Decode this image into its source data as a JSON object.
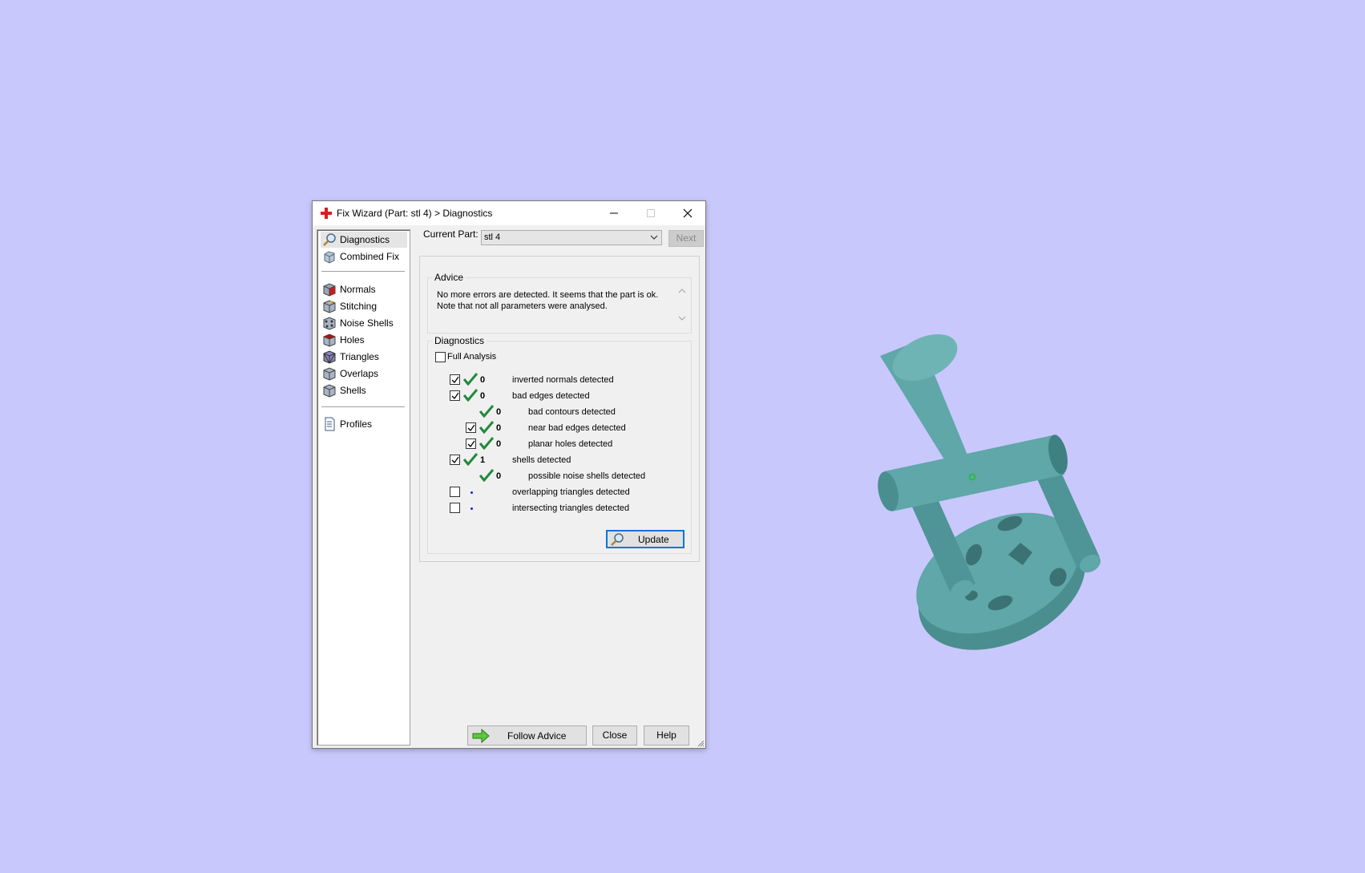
{
  "window": {
    "title": "Fix Wizard (Part: stl 4) > Diagnostics"
  },
  "nav": {
    "items": [
      {
        "label": "Diagnostics",
        "icon": "magnifier-icon"
      },
      {
        "label": "Combined Fix",
        "icon": "combined-fix-icon"
      },
      {
        "label": "Normals",
        "icon": "normals-cube-icon"
      },
      {
        "label": "Stitching",
        "icon": "stitching-cube-icon"
      },
      {
        "label": "Noise Shells",
        "icon": "noise-shells-icon"
      },
      {
        "label": "Holes",
        "icon": "holes-cube-icon"
      },
      {
        "label": "Triangles",
        "icon": "triangles-cube-icon"
      },
      {
        "label": "Overlaps",
        "icon": "overlaps-cube-icon"
      },
      {
        "label": "Shells",
        "icon": "shells-cube-icon"
      },
      {
        "label": "Profiles",
        "icon": "document-icon"
      }
    ],
    "selected": "Diagnostics"
  },
  "current_part": {
    "label": "Current Part:",
    "value": "stl 4",
    "next_label": "Next"
  },
  "advice": {
    "title": "Advice",
    "text_line1": "No more errors are detected. It seems that the part is ok.",
    "text_line2": "Note that not all parameters were analysed."
  },
  "diagnostics": {
    "title": "Diagnostics",
    "full_analysis_label": "Full Analysis",
    "full_analysis_checked": false,
    "rows": [
      {
        "label": "inverted normals detected",
        "value": "0",
        "checked": true,
        "status": "ok"
      },
      {
        "label": "bad edges detected",
        "value": "0",
        "checked": true,
        "status": "ok"
      },
      {
        "label": "bad contours detected",
        "value": "0",
        "status": "ok"
      },
      {
        "label": "near bad edges detected",
        "value": "0",
        "checked": true,
        "status": "ok"
      },
      {
        "label": "planar holes detected",
        "value": "0",
        "checked": true,
        "status": "ok"
      },
      {
        "label": "shells detected",
        "value": "1",
        "checked": true,
        "status": "ok"
      },
      {
        "label": "possible noise shells detected",
        "value": "0",
        "status": "ok"
      },
      {
        "label": "overlapping triangles detected",
        "value": "",
        "checked": false,
        "status": "not-analysed"
      },
      {
        "label": "intersecting triangles detected",
        "value": "",
        "checked": false,
        "status": "not-analysed"
      }
    ],
    "update_label": "Update"
  },
  "footer": {
    "follow_label": "Follow Advice",
    "close_label": "Close",
    "help_label": "Help"
  },
  "colors": {
    "background": "#c8c8fc",
    "model": "#5fa7a8",
    "check_green": "#1f8a3a",
    "accent": "#0078d7"
  }
}
